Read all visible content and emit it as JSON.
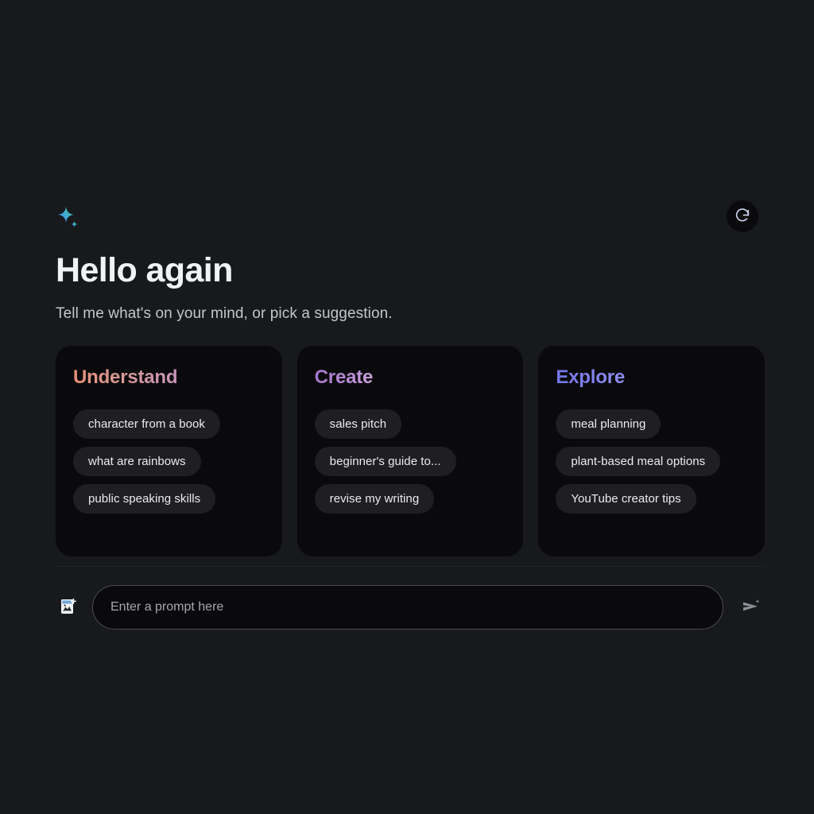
{
  "background_color": "#17191C",
  "header": {
    "sparkle_icon": "sparkle-icon",
    "refresh_icon": "refresh-icon",
    "refresh_label": "Refresh suggestions",
    "title": "Hello again",
    "subtitle": "Tell me what's on your mind, or pick a suggestion."
  },
  "cards": [
    {
      "title": "Understand",
      "accent_from": "#E89079",
      "accent_to": "#C893BD",
      "chips": [
        "character from a book",
        "what are rainbows",
        "public speaking skills"
      ]
    },
    {
      "title": "Create",
      "accent_from": "#A274C9",
      "accent_to": "#CDA2DE",
      "chips": [
        "sales pitch",
        "beginner's guide to...",
        "revise my writing"
      ]
    },
    {
      "title": "Explore",
      "accent_from": "#7474E6",
      "accent_to": "#9090F3",
      "chips": [
        "meal planning",
        "plant-based meal options",
        "YouTube creator tips"
      ]
    }
  ],
  "prompt_bar": {
    "attach_icon": "add-image-icon",
    "attach_label": "Add image",
    "placeholder": "Enter a prompt here",
    "value": "",
    "send_icon": "send-sparkle-icon",
    "send_label": "Send"
  }
}
